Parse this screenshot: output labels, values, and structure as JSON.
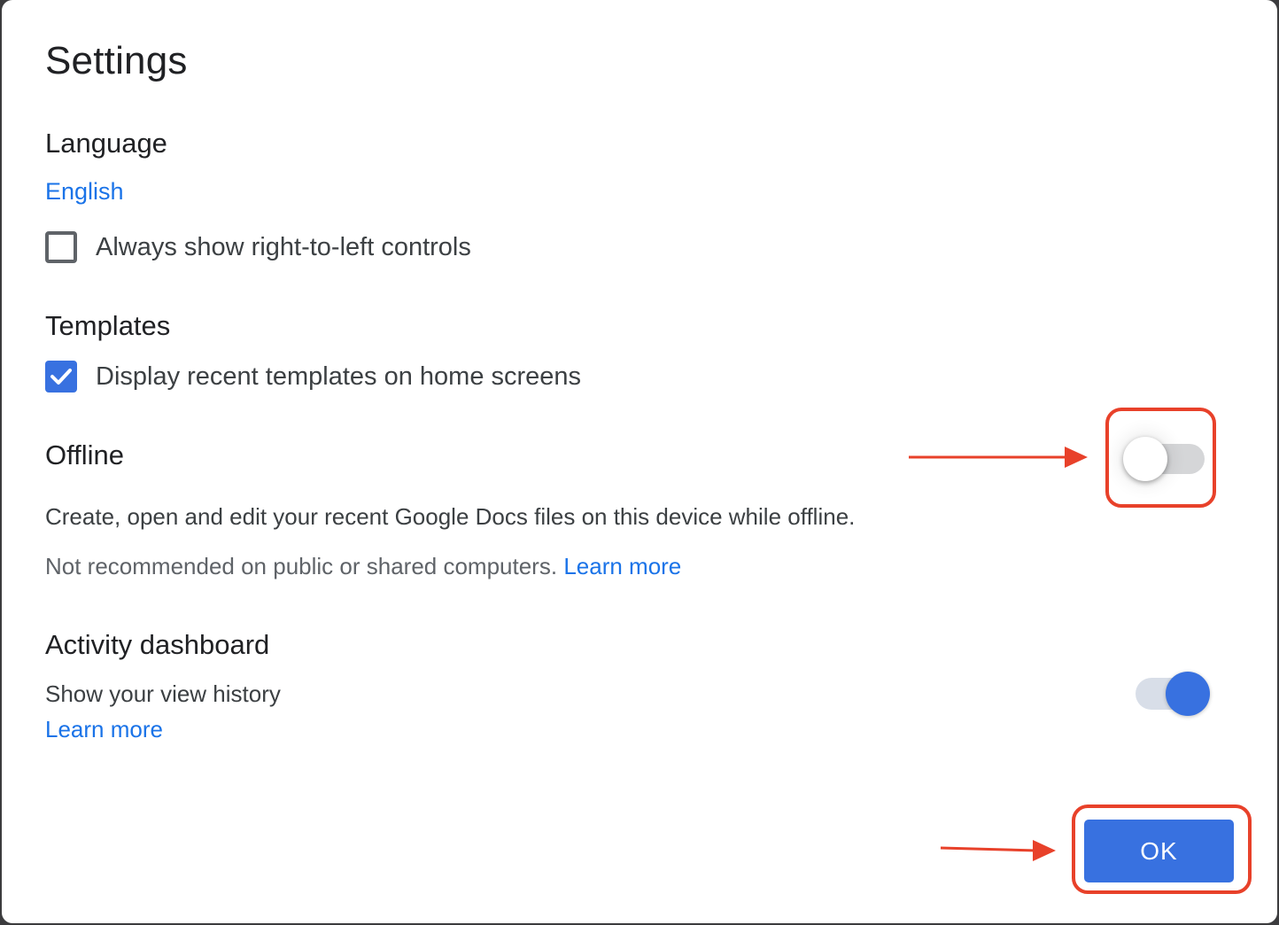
{
  "dialog": {
    "title": "Settings",
    "ok_label": "OK"
  },
  "language": {
    "heading": "Language",
    "current": "English",
    "rtl_checkbox": {
      "label": "Always show right-to-left controls",
      "checked": false
    }
  },
  "templates": {
    "heading": "Templates",
    "recent_checkbox": {
      "label": "Display recent templates on home screens",
      "checked": true
    }
  },
  "offline": {
    "heading": "Offline",
    "description": "Create, open and edit your recent Google Docs files on this device while offline.",
    "note": "Not recommended on public or shared computers.",
    "learn_more": "Learn more",
    "toggle_on": false
  },
  "activity": {
    "heading": "Activity dashboard",
    "description": "Show your view history",
    "learn_more": "Learn more",
    "toggle_on": true
  },
  "colors": {
    "accent": "#3871e0",
    "link": "#1a73e8",
    "annotation": "#e8412a"
  },
  "annotations": [
    {
      "target": "offline-toggle",
      "type": "arrow-and-box"
    },
    {
      "target": "ok-button",
      "type": "arrow-and-box"
    }
  ]
}
